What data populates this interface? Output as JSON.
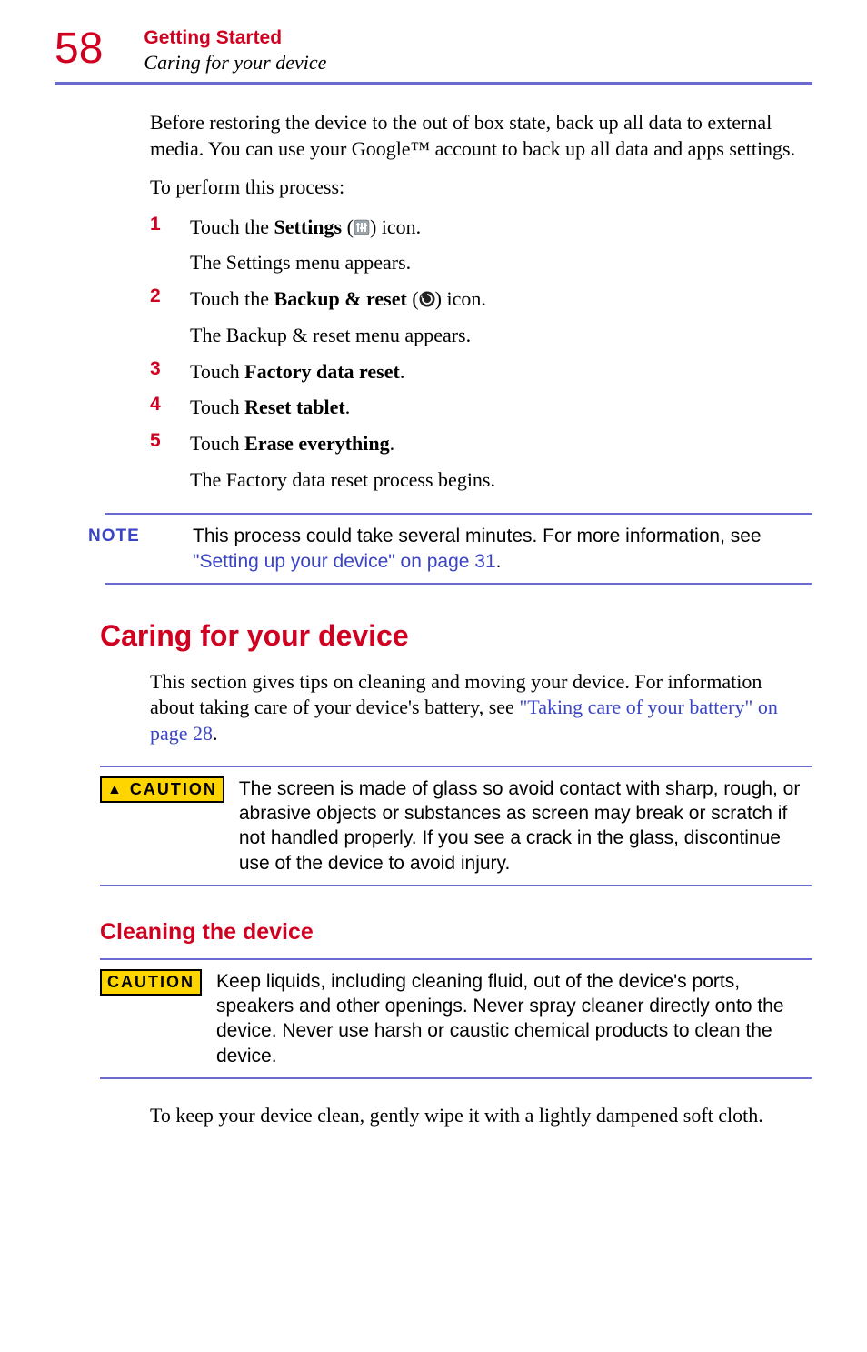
{
  "page": {
    "number": "58",
    "chapter": "Getting Started",
    "subsection": "Caring for your device"
  },
  "intro_para": "Before restoring the device to the out of box state, back up all data to external media. You can use your Google™ account to back up all data and apps settings.",
  "to_perform": "To perform this process:",
  "steps": [
    {
      "num": "1",
      "pre": "Touch the ",
      "bold": "Settings",
      "post": " (",
      "post2": ") icon.",
      "sub": "The Settings menu appears."
    },
    {
      "num": "2",
      "pre": "Touch the ",
      "bold": "Backup & reset",
      "post": " (",
      "post2": ") icon.",
      "sub": "The Backup & reset menu appears."
    },
    {
      "num": "3",
      "pre": "Touch ",
      "bold": "Factory data reset",
      "post": ".",
      "sub": ""
    },
    {
      "num": "4",
      "pre": "Touch ",
      "bold": "Reset tablet",
      "post": ".",
      "sub": ""
    },
    {
      "num": "5",
      "pre": "Touch ",
      "bold": "Erase everything",
      "post": ".",
      "sub": "The Factory data reset process begins."
    }
  ],
  "note": {
    "label": "NOTE",
    "text1": "This process could take several minutes. For more information, see ",
    "link": "\"Setting up your device\" on page 31",
    "text2": "."
  },
  "h1": "Caring for your device",
  "caring_para1": "This section gives tips on cleaning and moving your device. For information about taking care of your device's battery, see ",
  "caring_link": "\"Taking care of your battery\" on page 28",
  "caring_para2": ".",
  "caution1": {
    "label": "CAUTION",
    "body": "The screen is made of glass so avoid contact with sharp, rough, or abrasive objects or substances as screen may break or scratch if not handled properly. If you see a crack in the glass, discontinue use of the device to avoid injury."
  },
  "h2": "Cleaning the device",
  "caution2": {
    "label": "CAUTION",
    "body": "Keep liquids, including cleaning fluid, out of the device's ports, speakers and other openings. Never spray cleaner directly onto the device. Never use harsh or caustic chemical products to clean the device."
  },
  "final_para": "To keep your device clean, gently wipe it with a lightly dampened soft cloth."
}
